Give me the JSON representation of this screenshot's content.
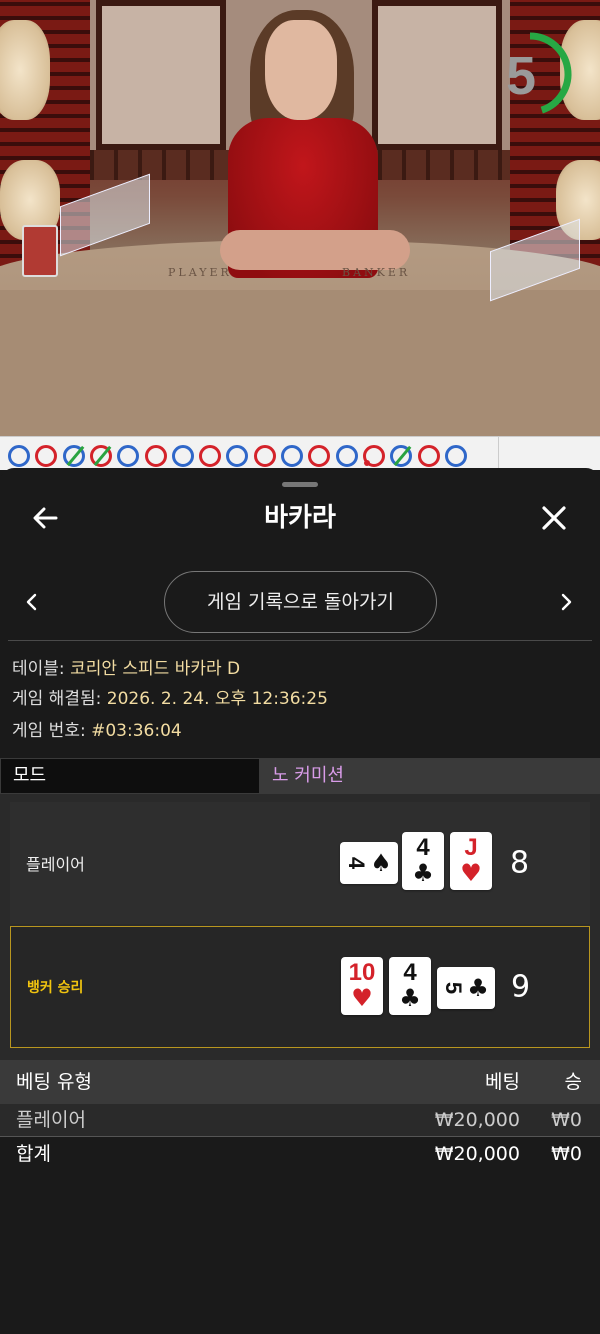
{
  "video": {
    "table_label_player": "PLAYER",
    "table_label_banker": "BANKER",
    "timer_value": "5",
    "timer_progress": 0.6,
    "colors": {
      "timer_arc": "#27a844"
    }
  },
  "roadmap": {
    "beads": [
      "B",
      "R",
      "B-tie",
      "R-tie",
      "B",
      "R",
      "B",
      "R",
      "B",
      "R",
      "B",
      "R",
      "B",
      "R-dot",
      "B-tie",
      "R",
      "B"
    ],
    "colors": {
      "banker": "#d4222a",
      "player": "#2f67c9",
      "tie": "#2aa340"
    }
  },
  "sheet": {
    "title": "바카라",
    "return_button": "게임 기록으로 돌아가기",
    "info": {
      "table_label": "테이블: ",
      "table_value": "코리안 스피드 바카라 D",
      "resolved_label": "게임 해결됨: ",
      "resolved_value": "2026. 2. 24. 오후 12:36:25",
      "number_label": "게임 번호: ",
      "number_value": "#03:36:04"
    },
    "mode": {
      "label": "모드",
      "value": "노 커미션"
    },
    "hands": {
      "player": {
        "label": "플레이어",
        "score": "8",
        "cards": [
          {
            "rank": "4",
            "suit": "♠",
            "color": "blk",
            "orientation": "side"
          },
          {
            "rank": "4",
            "suit": "♣",
            "color": "blk",
            "orientation": "up"
          },
          {
            "rank": "J",
            "suit": "♥",
            "color": "red",
            "orientation": "up"
          }
        ]
      },
      "banker": {
        "label": "뱅커 승리",
        "score": "9",
        "cards": [
          {
            "rank": "10",
            "suit": "♥",
            "color": "red",
            "orientation": "up"
          },
          {
            "rank": "4",
            "suit": "♣",
            "color": "blk",
            "orientation": "up"
          },
          {
            "rank": "5",
            "suit": "♣",
            "color": "blk",
            "orientation": "side"
          }
        ]
      },
      "colors": {
        "winner_border": "#b8961f",
        "winner_label": "#f1c40f"
      }
    },
    "bets": {
      "headers": {
        "type": "베팅 유형",
        "bet": "베팅",
        "win": "승"
      },
      "rows": [
        {
          "type": "플레이어",
          "bet": "₩20,000",
          "win": "₩0"
        }
      ],
      "total": {
        "type": "합계",
        "bet": "₩20,000",
        "win": "₩0"
      }
    }
  }
}
